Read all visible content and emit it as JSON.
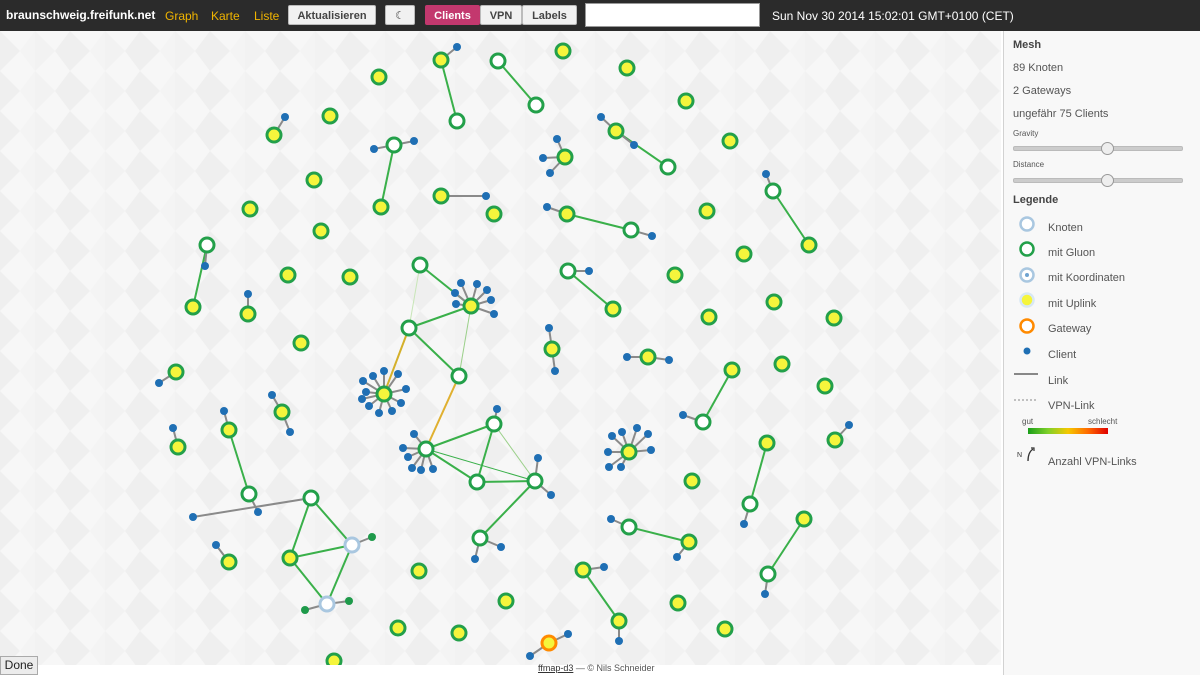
{
  "header": {
    "brand": "braunschweig.freifunk.net",
    "nav": {
      "graph": "Graph",
      "karte": "Karte",
      "liste": "Liste"
    },
    "refresh_label": "Aktualisieren",
    "moon_icon": "☾",
    "toggles": {
      "clients": "Clients",
      "vpn": "VPN",
      "labels": "Labels"
    },
    "search_value": "",
    "clock": "Sun Nov 30 2014 15:02:01 GMT+0100 (CET)"
  },
  "sidebar": {
    "mesh_title": "Mesh",
    "nodes": "89 Knoten",
    "gateways": "2 Gateways",
    "clients": "ungefähr 75 Clients",
    "gravity_label": "Gravity",
    "gravity_value": 0.56,
    "distance_label": "Distance",
    "distance_value": 0.56,
    "legend_title": "Legende",
    "legend": {
      "knoten": "Knoten",
      "gluon": "mit Gluon",
      "koordinaten": "mit Koordinaten",
      "uplink": "mit Uplink",
      "gateway": "Gateway",
      "client": "Client",
      "link": "Link",
      "vpn_link": "VPN-Link",
      "gut": "gut",
      "schlecht": "schlecht",
      "vpn_links": "Anzahl VPN-Links",
      "vpn_badge": "N"
    }
  },
  "footer": {
    "link": "ffmap-d3",
    "credit": " — © Nils Schneider"
  },
  "done_label": "Done",
  "colors": {
    "topbar": "#2b2b2b",
    "nav_link": "#f0b400",
    "active_toggle": "#c3386e",
    "gluon_ring": "#23a04a",
    "uplink_fill": "#f5f53c",
    "plain_ring": "#a9c7e0",
    "gateway_ring": "#ff8a00",
    "client": "#1f6fb4",
    "link": "#3ab04a"
  }
}
